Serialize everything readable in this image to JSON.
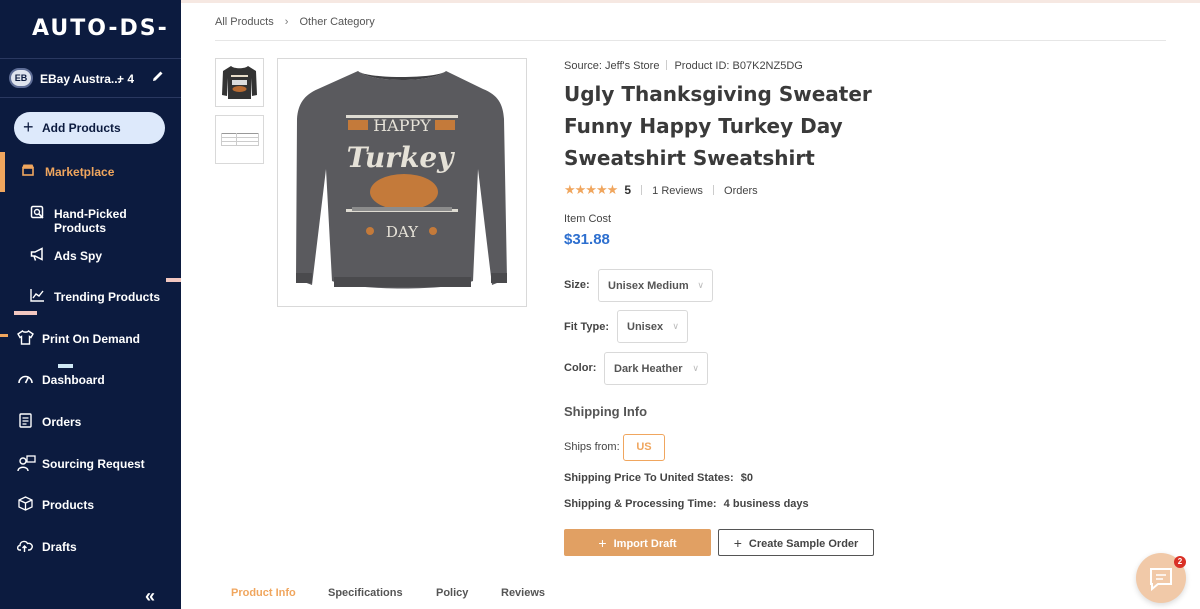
{
  "app": {
    "logo": "AUTO-DS-"
  },
  "store": {
    "avatar_initials": "EB",
    "name": "EBay Austra...",
    "extra_count": "+ 4"
  },
  "sidebar": {
    "add_products_label": "Add Products",
    "items": [
      {
        "label": "Marketplace",
        "icon": "store-icon",
        "active": true
      },
      {
        "label": "Hand-Picked Products",
        "icon": "hand-picked-icon"
      },
      {
        "label": "Ads Spy",
        "icon": "megaphone-icon"
      },
      {
        "label": "Trending Products",
        "icon": "trend-chart-icon"
      },
      {
        "label": "Print On Demand",
        "icon": "shirt-icon"
      },
      {
        "label": "Dashboard",
        "icon": "gauge-icon"
      },
      {
        "label": "Orders",
        "icon": "orders-icon"
      },
      {
        "label": "Sourcing Request",
        "icon": "sourcing-icon"
      },
      {
        "label": "Products",
        "icon": "box-icon"
      },
      {
        "label": "Drafts",
        "icon": "cloud-upload-icon"
      }
    ],
    "collapse_glyph": "«"
  },
  "breadcrumb": {
    "root": "All Products",
    "current": "Other Category"
  },
  "product": {
    "source": "Source: Jeff's Store",
    "product_id": "Product ID: B07K2NZ5DG",
    "title": "Ugly Thanksgiving Sweater Funny Happy Turkey Day Sweatshirt Sweatshirt",
    "rating": "5",
    "stars": "★★★★★",
    "reviews": "1 Reviews",
    "orders": "Orders",
    "item_cost_label": "Item Cost",
    "item_cost": "$31.88",
    "sweater_text": {
      "line1": "HAPPY",
      "line2": "Turkey",
      "line3": "DAY"
    }
  },
  "options": {
    "size": {
      "label": "Size:",
      "value": "Unisex Medium"
    },
    "fit": {
      "label": "Fit Type:",
      "value": "Unisex"
    },
    "color": {
      "label": "Color:",
      "value": "Dark Heather"
    }
  },
  "shipping": {
    "heading": "Shipping Info",
    "ships_from_label": "Ships from:",
    "ships_from_value": "US",
    "price_label": "Shipping Price To United States:",
    "price_value": "$0",
    "time_label": "Shipping & Processing Time:",
    "time_value": "4 business days"
  },
  "actions": {
    "import_label": "Import Draft",
    "sample_label": "Create Sample Order"
  },
  "tabs": [
    "Product Info",
    "Specifications",
    "Policy",
    "Reviews"
  ],
  "chat": {
    "badge": "2"
  },
  "colors": {
    "sidebar_bg": "#0c1b3f",
    "accent": "#f0a65e",
    "price_blue": "#2d6fcf",
    "add_button_bg": "#dde9fb"
  }
}
